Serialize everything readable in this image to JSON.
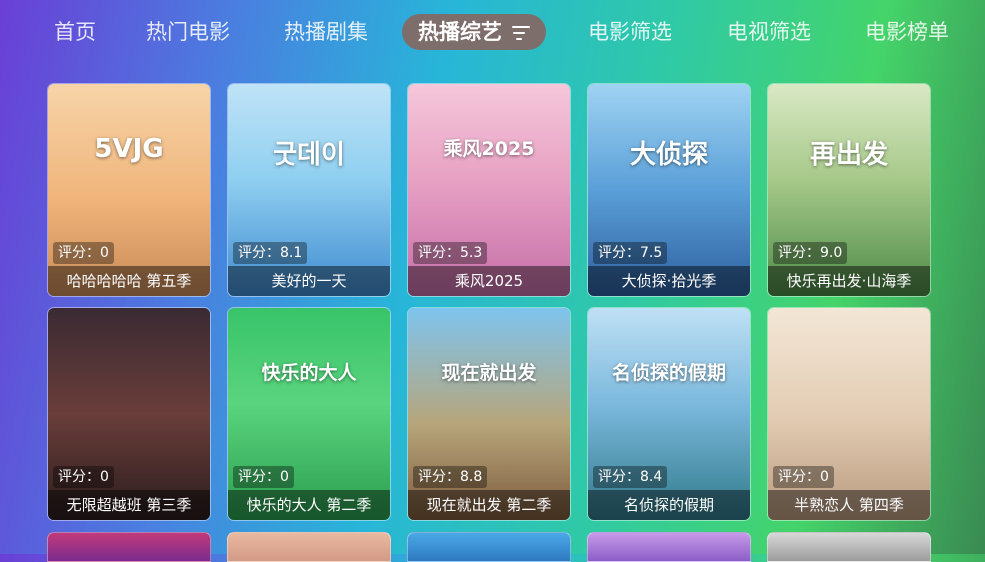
{
  "nav": {
    "items": [
      "首页",
      "热门电影",
      "热播剧集",
      "热播综艺",
      "电影筛选",
      "电视筛选",
      "电影榜单"
    ],
    "active_index": 3
  },
  "cards": [
    {
      "title": "哈哈哈哈哈 第五季",
      "score": "评分：0",
      "logo": "5VJG",
      "poster": "linear-gradient(180deg,#f6d4a8 0%,#f0b47a 55%,#c98a57 100%)"
    },
    {
      "title": "美好的一天",
      "score": "评分：8.1",
      "logo": "굿데이",
      "poster": "linear-gradient(180deg,#bfe3f7 0%,#8fcff0 45%,#3f8bd0 100%)"
    },
    {
      "title": "乘风2025",
      "score": "评分：5.3",
      "logo": "乘风2025",
      "poster": "linear-gradient(180deg,#f5c7da 0%,#e7a1c3 45%,#c56ea8 100%)"
    },
    {
      "title": "大侦探·拾光季",
      "score": "评分：7.5",
      "logo": "大侦探",
      "poster": "linear-gradient(180deg,#9fd3f2 0%,#5a9fd8 50%,#2d5f9f 100%)"
    },
    {
      "title": "快乐再出发·山海季",
      "score": "评分：9.0",
      "logo": "再出发",
      "poster": "linear-gradient(180deg,#d9e8c4 0%,#a7c98a 45%,#4c8a47 100%)"
    },
    {
      "title": "无限超越班 第三季",
      "score": "评分：0",
      "logo": "",
      "poster": "linear-gradient(180deg,#3a2a33 0%,#6a3e3a 50%,#2a1c1e 100%)"
    },
    {
      "title": "快乐的大人 第二季",
      "score": "评分：0",
      "logo": "快乐的大人",
      "poster": "linear-gradient(180deg,#38c46a 0%,#5ad47e 45%,#2a9e4f 100%)"
    },
    {
      "title": "现在就出发 第二季",
      "score": "评分：8.8",
      "logo": "现在就出发",
      "poster": "linear-gradient(180deg,#7ec4ef 0%,#b7a57a 55%,#7d5b3d 100%)"
    },
    {
      "title": "名侦探的假期",
      "score": "评分：8.4",
      "logo": "名侦探的假期",
      "poster": "linear-gradient(180deg,#bfe0f5 0%,#7cb9dd 45%,#2f7a8a 100%)"
    },
    {
      "title": "半熟恋人 第四季",
      "score": "评分：0",
      "logo": "",
      "poster": "linear-gradient(180deg,#f3e6d6 0%,#e3cdb4 50%,#b99a7e 100%)"
    }
  ],
  "row3_posters": [
    "linear-gradient(180deg,#c23a7a,#7a2b8f)",
    "linear-gradient(180deg,#e9b9a2,#d39a86)",
    "linear-gradient(180deg,#4aa8e6,#2f7ac2)",
    "linear-gradient(180deg,#c79ae9,#8b5ec7)",
    "linear-gradient(180deg,#d8d8d8,#9c9c9c)"
  ]
}
